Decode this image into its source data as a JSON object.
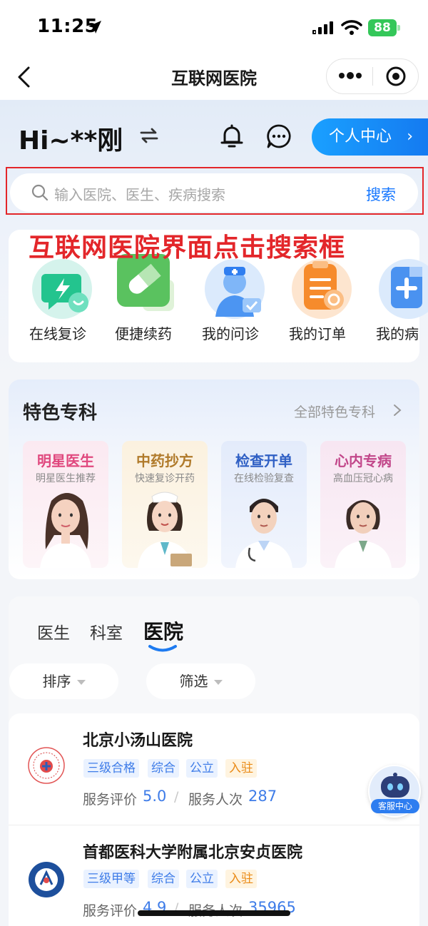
{
  "status_bar": {
    "time": "11:25",
    "battery": "88"
  },
  "nav": {
    "title": "互联网医院"
  },
  "header": {
    "greeting": "Hi~**刚",
    "personal_center": "个人中心"
  },
  "search": {
    "placeholder": "输入医院、医生、疾病搜索",
    "button": "搜索"
  },
  "annotation": "互联网医院界面点击搜索框",
  "quick_services": [
    {
      "label": "在线复诊",
      "icon": "online-revisit-icon"
    },
    {
      "label": "便捷续药",
      "icon": "medicine-refill-icon"
    },
    {
      "label": "我的问诊",
      "icon": "doctor-consult-icon"
    },
    {
      "label": "我的订单",
      "icon": "order-icon"
    },
    {
      "label": "我的病",
      "icon": "medical-record-icon"
    }
  ],
  "featured": {
    "title": "特色专科",
    "more": "全部特色专科",
    "cards": [
      {
        "title": "明星医生",
        "subtitle": "明星医生推荐",
        "color": "#e0487e"
      },
      {
        "title": "中药抄方",
        "subtitle": "快速复诊开药",
        "color": "#b07a2a"
      },
      {
        "title": "检查开单",
        "subtitle": "在线检验复查",
        "color": "#2f5fc4"
      },
      {
        "title": "心内专病",
        "subtitle": "高血压冠心病",
        "color": "#c2478a"
      }
    ]
  },
  "tabs": [
    {
      "label": "医生"
    },
    {
      "label": "科室"
    },
    {
      "label": "医院",
      "active": true
    }
  ],
  "filters": {
    "sort": "排序",
    "filter": "筛选"
  },
  "hospitals": [
    {
      "name": "北京小汤山医院",
      "tags": [
        "三级合格",
        "综合",
        "公立"
      ],
      "highlight_tag": "入驻",
      "rating_label": "服务评价",
      "rating": "5.0",
      "visits_label": "服务人次",
      "visits": "287"
    },
    {
      "name": "首都医科大学附属北京安贞医院",
      "tags": [
        "三级甲等",
        "综合",
        "公立"
      ],
      "highlight_tag": "入驻",
      "rating_label": "服务评价",
      "rating": "4.9",
      "visits_label": "服务人次",
      "visits": "35965"
    }
  ],
  "floating": {
    "label": "客服中心"
  },
  "colors": {
    "accent": "#1677ff",
    "annotation": "#e3262a",
    "success": "#34c759"
  }
}
